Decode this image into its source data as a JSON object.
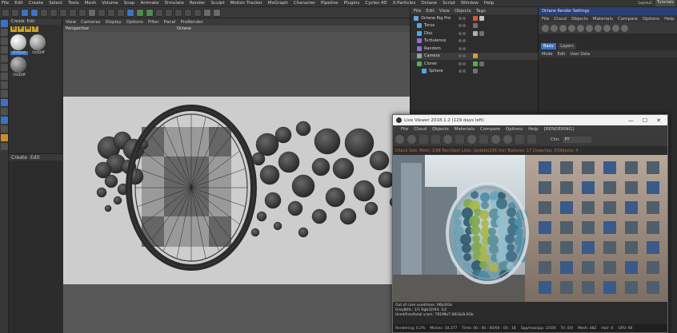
{
  "main_menu": [
    "File",
    "Edit",
    "Create",
    "Select",
    "Tools",
    "Mesh",
    "Volume",
    "Snap",
    "Animate",
    "Simulate",
    "Render",
    "Sculpt",
    "Motion Tracker",
    "MoGraph",
    "Character",
    "Pipeline",
    "Plugins",
    "Cycles 4D",
    "X-Particles",
    "Octane",
    "Script",
    "Window",
    "Help"
  ],
  "layout": {
    "label": "Layout:",
    "value": "Tutorials"
  },
  "material_panel": {
    "menu": [
      "Create",
      "Edit"
    ],
    "tabs": [
      "D",
      "P",
      "M",
      "T"
    ],
    "materials": [
      {
        "name": "Octane",
        "color": "#e8e8e8",
        "selected": true
      },
      {
        "name": "OctDiff",
        "color": "#a8a8a8",
        "selected": false
      },
      {
        "name": "OctDiff",
        "color": "#8c8c8c",
        "selected": false
      }
    ]
  },
  "object_panel_left": {
    "menu": [
      "Create",
      "Edit"
    ]
  },
  "viewport": {
    "menu": [
      "View",
      "Cameras",
      "Display",
      "Options",
      "Filter",
      "Panel",
      "ProRender"
    ],
    "label_left": "Perspective",
    "label_center": "Octane"
  },
  "object_manager": {
    "menu": [
      "File",
      "Edit",
      "View",
      "Objects",
      "Tags"
    ],
    "rows": [
      {
        "name": "Octane Rig Pro",
        "icon_color": "#6fa0e0",
        "tags": [
          "#d45a3a",
          "#c0c0c0"
        ],
        "selected": false
      },
      {
        "name": "Torus",
        "icon_color": "#4aa8e8",
        "tags": [
          "#707070"
        ],
        "selected": false
      },
      {
        "name": "Disc",
        "icon_color": "#4aa8e8",
        "tags": [
          "#b0b0b0",
          "#707070"
        ],
        "selected": false
      },
      {
        "name": "Turbulence",
        "icon_color": "#8c6fd0",
        "tags": [],
        "selected": false
      },
      {
        "name": "Random",
        "icon_color": "#8c6fd0",
        "tags": [],
        "selected": false
      },
      {
        "name": "Camera",
        "icon_color": "#a0a0a0",
        "tags": [
          "#d0a030"
        ],
        "selected": true
      },
      {
        "name": "Cloner",
        "icon_color": "#4fb04f",
        "tags": [
          "#4fb04f",
          "#6a6a6a"
        ],
        "selected": false
      },
      {
        "name": "Sphere",
        "icon_color": "#4aa8e8",
        "tags": [
          "#707070"
        ],
        "selected": false
      }
    ]
  },
  "render_settings": {
    "title": "Octane Render Settings",
    "menu": [
      "File",
      "Cloud",
      "Objects",
      "Materials",
      "Compare",
      "Options",
      "Help"
    ],
    "tabs": [
      {
        "label": "Basic",
        "active": true
      },
      {
        "label": "Layers",
        "active": false
      }
    ],
    "submenu": [
      "Mode",
      "Edit",
      "User Data"
    ]
  },
  "live_viewer": {
    "title": "Live Viewer 2018.1.2 (129 days left)",
    "window_buttons": [
      "—",
      "☐",
      "✕"
    ],
    "menu": [
      "File",
      "Cloud",
      "Objects",
      "Materials",
      "Compare",
      "Options",
      "Help",
      "[RENDERING]"
    ],
    "channel_label": "Chn:",
    "channel_value": "PT",
    "status": "Check Geo. Mem: 1/98 Rec(Geo) Lists: Update(256 ms) Textures: 17 Draw/rep: 3/Objects: 4",
    "info_lines": [
      "Out of core used/max: 0Kb/4Gb",
      "GreyB/hL: 1/1          Rgb32/64: 1/2",
      "Used/free/total vram: 781Mb/7.86Gb/8.0Gb"
    ],
    "bottom_stats": [
      "Rendering: 0.2%",
      "Ms/sec: 10.377",
      "Time: 00 : 00 : 00/00 : 00 : 18",
      "Spp/maxspp: 1/500",
      "Tri: 0/0",
      "Mesh: 482",
      "Hair: 0",
      "GPU: 66"
    ]
  },
  "colors": {
    "accent_blue": "#3b73c4",
    "title_blue": "#2a3f73",
    "viewport_bg": "#cdcdcd",
    "status_orange": "#d36a3a"
  }
}
